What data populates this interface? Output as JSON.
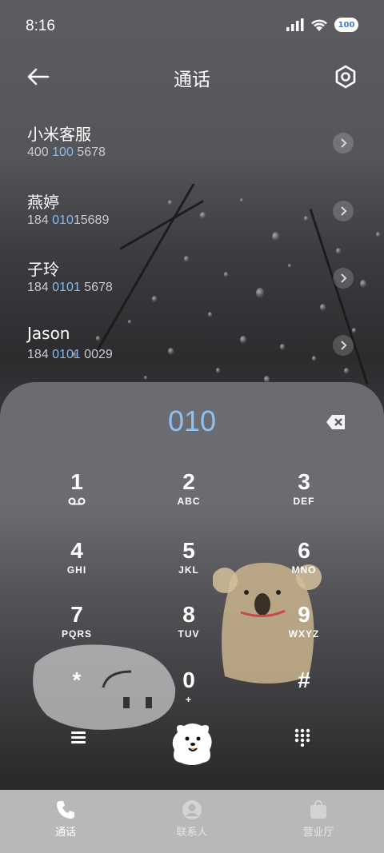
{
  "status": {
    "time": "8:16",
    "battery": "100"
  },
  "header": {
    "title": "通话"
  },
  "contacts": [
    {
      "name": "小米客服",
      "num_a": "400 ",
      "num_hl": "100",
      "num_b": " 5678"
    },
    {
      "name": "燕婷",
      "num_a": "184 ",
      "num_hl": "010",
      "num_b": "15689"
    },
    {
      "name": "子玲",
      "num_a": "184 ",
      "num_hl": "0101",
      "num_b": " 5678"
    },
    {
      "name": "Jason",
      "num_a": "184 ",
      "num_hl": "0101",
      "num_b": " 0029"
    }
  ],
  "dialpad": {
    "input": "010",
    "keys": [
      {
        "digit": "1",
        "letters": ""
      },
      {
        "digit": "2",
        "letters": "ABC"
      },
      {
        "digit": "3",
        "letters": "DEF"
      },
      {
        "digit": "4",
        "letters": "GHI"
      },
      {
        "digit": "5",
        "letters": "JKL"
      },
      {
        "digit": "6",
        "letters": "MNO"
      },
      {
        "digit": "7",
        "letters": "PQRS"
      },
      {
        "digit": "8",
        "letters": "TUV"
      },
      {
        "digit": "9",
        "letters": "WXYZ"
      },
      {
        "digit": "*",
        "letters": ""
      },
      {
        "digit": "0",
        "letters": "+"
      },
      {
        "digit": "#",
        "letters": ""
      }
    ]
  },
  "nav": {
    "calls": "通话",
    "contacts": "联系人",
    "hall": "营业厅"
  },
  "colors": {
    "highlight": "#8ab9ea",
    "input": "#8ec0f0",
    "nav_bg": "#b7b8ba"
  },
  "icons": [
    "back-arrow-icon",
    "settings-icon",
    "chevron-right-icon",
    "voicemail-icon",
    "backspace-icon",
    "menu-icon",
    "keypad-icon",
    "phone-icon",
    "person-icon",
    "bag-icon"
  ]
}
